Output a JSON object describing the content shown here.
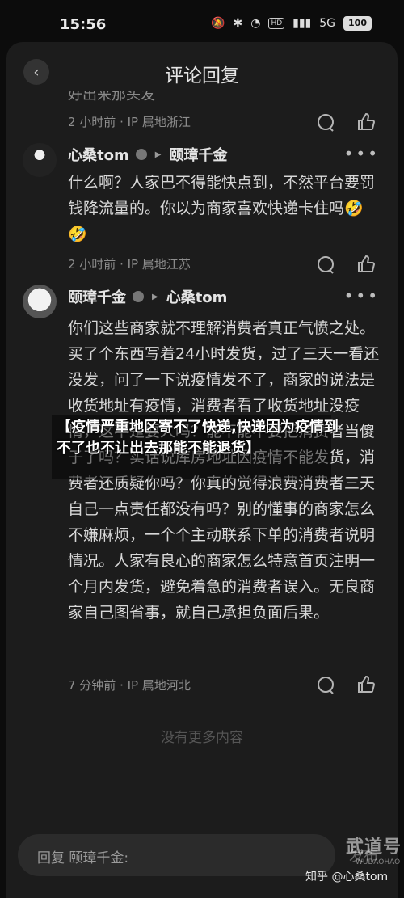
{
  "status_bar": {
    "time": "15:56",
    "battery": "100",
    "hd": "HD",
    "signal_label": "5G"
  },
  "header": {
    "title": "评论回复"
  },
  "clipped_prev_text": "好出来那头发",
  "prev_comment": {
    "meta": "2 小时前 · IP 属地浙江"
  },
  "comments": [
    {
      "author": "心桑tom",
      "reply_to": "颐璋千金",
      "text": "什么啊？人家巴不得能快点到，不然平台要罚钱降流量的。你以为商家喜欢快递卡住吗🤣🤣",
      "meta": "2 小时前 · IP 属地江苏"
    },
    {
      "author": "颐璋千金",
      "reply_to": "心桑tom",
      "text": "你们这些商家就不理解消费者真正气愤之处。买了个东西写着24小时发货，过了三天一看还没发，问了一下说疫情发不了，商家的说法是收货地址有疫情，消费者看了收货地址没疫情，这不是耍人吗？能不能不要把消费者当傻子了吗？实话说库房地址因疫情不能发货，消费者还质疑你吗？你真的觉得浪费消费者三天自己一点责任都没有吗？别的懂事的商家怎么不嫌麻烦，一个个主动联系下单的消费者说明情况。人家有良心的商家怎么特意首页注明一个月内发货，避免着急的消费者误入。无良商家自己图省事，就自己承担负面后果。",
      "meta": "7 分钟前 · IP 属地河北"
    }
  ],
  "no_more": "没有更多内容",
  "reply_bar": {
    "placeholder": "回复 颐璋千金:",
    "send": "发布"
  },
  "overlay": {
    "text": "【疫情严重地区寄不了快递,快递因为疫情到不了也不让出去那能不能退货】"
  },
  "watermarks": {
    "zhihu": "知乎 @心桑tom",
    "site": "武道号",
    "site_sub": "WUDAOHAO"
  },
  "icons": {
    "back": "chevron-left-icon",
    "comment": "comment-bubble-icon",
    "like": "thumbs-up-icon",
    "more": "more-dots-icon"
  }
}
